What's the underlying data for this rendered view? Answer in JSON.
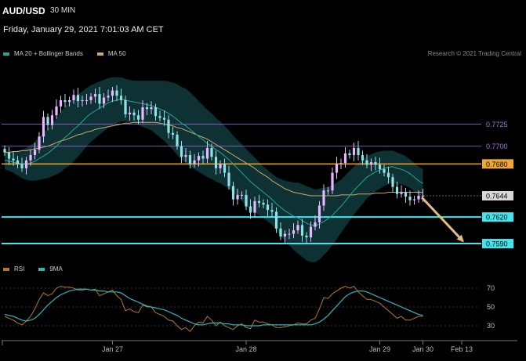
{
  "header": {
    "symbol": "AUD/USD",
    "timeframe": "30 MIN",
    "datetime": "Friday, January 29, 2021 7:01:03 AM CET",
    "credit": "Research © 2021 Trading Central"
  },
  "colors": {
    "bull": "#e6b8ff",
    "bear": "#8fe3e6",
    "ma20": "#2aa39a",
    "ma50": "#c9a96b",
    "band": "#10393d",
    "purple_level": "#a66fe6",
    "orange_level": "#f0a82e",
    "cyan_level": "#3fe6ee",
    "rsi": "#b07a2e",
    "rsi_ma": "#2fb7c0",
    "arrow": "#e2bc84"
  },
  "chart_data": [
    {
      "type": "candlestick",
      "title": "AUD/USD",
      "series": [
        {
          "name": "MA 20 + Bollinger Bands"
        },
        {
          "name": "MA 50"
        }
      ],
      "ylim": [
        0.7575,
        0.779
      ],
      "x_ticks": [
        {
          "label": "Jan 27",
          "index": 25
        },
        {
          "label": "Jan 28",
          "index": 56
        },
        {
          "label": "Jan 29",
          "index": 87
        },
        {
          "label": "Jan 30",
          "index": 97
        },
        {
          "label": "Feb 13",
          "index": 106
        }
      ],
      "levels": [
        {
          "value": 0.7725,
          "label": "0.7725",
          "role": "resistance-purple"
        },
        {
          "value": 0.77,
          "label": "0.7700",
          "role": "resistance-purple"
        },
        {
          "value": 0.768,
          "label": "0.7680",
          "role": "pivot-orange"
        },
        {
          "value": 0.7644,
          "label": "0.7644",
          "role": "last-price"
        },
        {
          "value": 0.762,
          "label": "0.7620",
          "role": "support-cyan"
        },
        {
          "value": 0.759,
          "label": "0.7590",
          "role": "support-cyan"
        }
      ],
      "closes": [
        0.7693,
        0.7686,
        0.7684,
        0.768,
        0.7675,
        0.7684,
        0.769,
        0.7696,
        0.7711,
        0.7733,
        0.7724,
        0.7735,
        0.7745,
        0.7752,
        0.775,
        0.7752,
        0.7758,
        0.7751,
        0.7752,
        0.7752,
        0.7756,
        0.7759,
        0.7748,
        0.7755,
        0.7757,
        0.7763,
        0.7757,
        0.7752,
        0.7736,
        0.7738,
        0.7735,
        0.773,
        0.7744,
        0.7742,
        0.7744,
        0.7734,
        0.7732,
        0.773,
        0.7715,
        0.7713,
        0.77,
        0.7688,
        0.769,
        0.768,
        0.7684,
        0.7689,
        0.7686,
        0.7698,
        0.7688,
        0.7675,
        0.768,
        0.767,
        0.7655,
        0.764,
        0.7645,
        0.7645,
        0.7632,
        0.7625,
        0.7638,
        0.7636,
        0.7634,
        0.7628,
        0.7626,
        0.7607,
        0.7598,
        0.7601,
        0.7601,
        0.7605,
        0.7611,
        0.7599,
        0.7597,
        0.7609,
        0.7614,
        0.7633,
        0.765,
        0.765,
        0.767,
        0.768,
        0.7681,
        0.7692,
        0.769,
        0.7698,
        0.769,
        0.7684,
        0.7679,
        0.7682,
        0.7679,
        0.7674,
        0.767,
        0.7665,
        0.7654,
        0.7646,
        0.7648,
        0.7643,
        0.7639,
        0.764,
        0.7644,
        0.7644
      ],
      "ma20": [
        0.7684,
        0.7683,
        0.7682,
        0.7681,
        0.768,
        0.768,
        0.7681,
        0.7683,
        0.7686,
        0.7689,
        0.7692,
        0.7696,
        0.77,
        0.7705,
        0.771,
        0.7714,
        0.7719,
        0.7723,
        0.7728,
        0.7733,
        0.7737,
        0.774,
        0.7743,
        0.7746,
        0.7749,
        0.7751,
        0.7752,
        0.7753,
        0.7752,
        0.7751,
        0.775,
        0.7749,
        0.7748,
        0.7747,
        0.7746,
        0.7744,
        0.7742,
        0.774,
        0.7737,
        0.7734,
        0.773,
        0.7726,
        0.7723,
        0.7719,
        0.7715,
        0.7711,
        0.7707,
        0.7703,
        0.77,
        0.7696,
        0.7693,
        0.7689,
        0.7685,
        0.768,
        0.7675,
        0.767,
        0.7665,
        0.766,
        0.7656,
        0.7652,
        0.7648,
        0.7644,
        0.764,
        0.7635,
        0.7631,
        0.7627,
        0.7624,
        0.7621,
        0.7619,
        0.7616,
        0.7613,
        0.7611,
        0.761,
        0.7612,
        0.7615,
        0.7618,
        0.7622,
        0.7627,
        0.7632,
        0.7638,
        0.7644,
        0.765,
        0.7655,
        0.766,
        0.7665,
        0.7668,
        0.7671,
        0.7673,
        0.7675,
        0.7676,
        0.7677,
        0.7675,
        0.7674,
        0.7672,
        0.7669,
        0.7665,
        0.7661,
        0.7658
      ],
      "ma50": [
        0.7693,
        0.7693,
        0.7694,
        0.7694,
        0.7695,
        0.7695,
        0.7696,
        0.7697,
        0.7698,
        0.7699,
        0.77,
        0.7702,
        0.7704,
        0.7706,
        0.7707,
        0.7709,
        0.7711,
        0.7713,
        0.7714,
        0.7716,
        0.7717,
        0.7719,
        0.772,
        0.7721,
        0.7722,
        0.7723,
        0.7724,
        0.7725,
        0.7726,
        0.7726,
        0.7727,
        0.7727,
        0.7727,
        0.7727,
        0.7727,
        0.7727,
        0.7726,
        0.7725,
        0.7724,
        0.7723,
        0.7721,
        0.772,
        0.7718,
        0.7716,
        0.7714,
        0.7712,
        0.771,
        0.7708,
        0.7705,
        0.7702,
        0.7699,
        0.7696,
        0.7693,
        0.769,
        0.7687,
        0.7684,
        0.7681,
        0.7678,
        0.7675,
        0.7671,
        0.7668,
        0.7665,
        0.7661,
        0.7658,
        0.7655,
        0.7652,
        0.765,
        0.7648,
        0.7647,
        0.7646,
        0.7645,
        0.7644,
        0.7644,
        0.7644,
        0.7644,
        0.7644,
        0.7644,
        0.7644,
        0.7645,
        0.7645,
        0.7645,
        0.7645,
        0.7646,
        0.7646,
        0.7646,
        0.7646,
        0.7647,
        0.7647,
        0.7647,
        0.7648,
        0.7648,
        0.7648,
        0.7648,
        0.7648,
        0.7648,
        0.7648,
        0.7648,
        0.7648
      ],
      "band_halfwidth": [
        0.001,
        0.0011,
        0.0012,
        0.0014,
        0.0016,
        0.0018,
        0.002,
        0.0022,
        0.0024,
        0.0026,
        0.0028,
        0.003,
        0.0032,
        0.0034,
        0.0035,
        0.0036,
        0.0036,
        0.0035,
        0.0034,
        0.0033,
        0.0032,
        0.0031,
        0.003,
        0.0029,
        0.0028,
        0.0027,
        0.0026,
        0.0025,
        0.0024,
        0.0024,
        0.0024,
        0.0025,
        0.0026,
        0.0027,
        0.0028,
        0.003,
        0.0032,
        0.0034,
        0.0036,
        0.0038,
        0.004,
        0.0041,
        0.0042,
        0.0042,
        0.0041,
        0.004,
        0.0039,
        0.0038,
        0.0037,
        0.0036,
        0.0035,
        0.0034,
        0.0033,
        0.0032,
        0.0032,
        0.0032,
        0.0032,
        0.0032,
        0.0031,
        0.003,
        0.0029,
        0.0029,
        0.0029,
        0.003,
        0.0032,
        0.0034,
        0.0036,
        0.0038,
        0.004,
        0.0041,
        0.0042,
        0.0042,
        0.0041,
        0.004,
        0.0038,
        0.0036,
        0.0034,
        0.0032,
        0.003,
        0.0029,
        0.0028,
        0.0027,
        0.0026,
        0.0025,
        0.0024,
        0.0023,
        0.0022,
        0.0021,
        0.002,
        0.0019,
        0.0018,
        0.0018,
        0.0017,
        0.0017,
        0.0016,
        0.0016,
        0.0016,
        0.0016
      ],
      "forecast_arrow": {
        "from": {
          "index": 96,
          "value": 0.7644
        },
        "to": {
          "index": 107,
          "value": 0.7592
        }
      },
      "legend_placement": "top-left"
    },
    {
      "type": "line",
      "series": [
        {
          "name": "RSI"
        },
        {
          "name": "9MA"
        }
      ],
      "ylim": [
        20,
        80
      ],
      "y_ticks": [
        70,
        50,
        30
      ],
      "rsi": [
        40,
        38,
        36,
        33,
        31,
        35,
        40,
        48,
        58,
        65,
        62,
        64,
        70,
        72,
        71,
        71,
        70,
        68,
        68,
        69,
        68,
        69,
        62,
        64,
        66,
        68,
        62,
        58,
        46,
        48,
        45,
        44,
        52,
        50,
        50,
        44,
        42,
        40,
        36,
        35,
        30,
        26,
        28,
        24,
        30,
        34,
        33,
        40,
        36,
        30,
        34,
        30,
        28,
        26,
        30,
        32,
        28,
        27,
        36,
        34,
        34,
        32,
        31,
        28,
        28,
        29,
        30,
        31,
        33,
        32,
        32,
        36,
        38,
        48,
        60,
        59,
        64,
        67,
        70,
        72,
        70,
        72,
        66,
        62,
        58,
        58,
        56,
        54,
        50,
        46,
        42,
        38,
        40,
        36,
        36,
        38,
        40,
        40
      ],
      "rsi_ma": [
        42,
        41,
        40,
        38,
        36,
        35,
        36,
        38,
        42,
        47,
        52,
        56,
        60,
        63,
        65,
        67,
        68,
        69,
        69,
        69,
        68,
        68,
        67,
        67,
        66,
        66,
        66,
        65,
        62,
        59,
        57,
        55,
        53,
        51,
        50,
        49,
        48,
        47,
        45,
        43,
        41,
        38,
        36,
        34,
        32,
        31,
        31,
        32,
        33,
        33,
        33,
        32,
        32,
        31,
        31,
        31,
        30,
        30,
        30,
        30,
        31,
        31,
        31,
        31,
        31,
        31,
        31,
        31,
        31,
        31,
        31,
        31,
        32,
        34,
        37,
        41,
        46,
        51,
        56,
        61,
        64,
        66,
        67,
        67,
        66,
        64,
        62,
        60,
        58,
        56,
        54,
        52,
        50,
        48,
        46,
        44,
        42,
        41
      ],
      "legend_placement": "top-left"
    }
  ]
}
